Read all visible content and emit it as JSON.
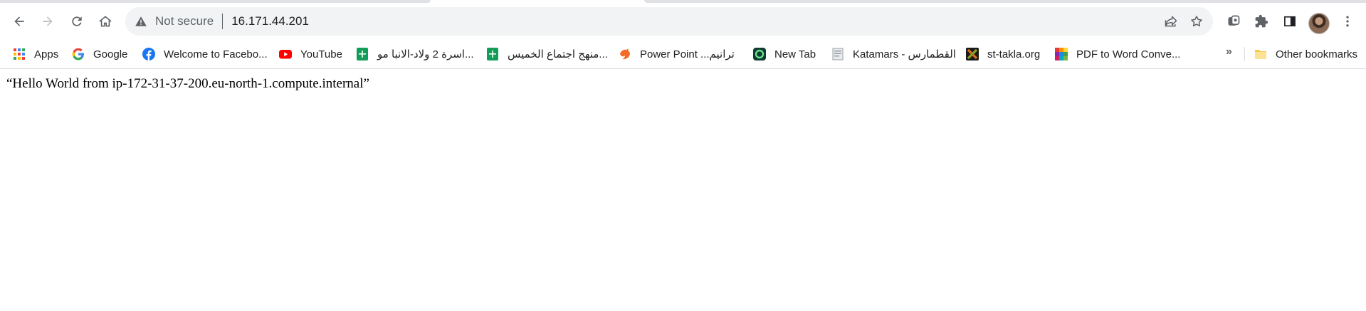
{
  "omnibox": {
    "security_label": "Not secure",
    "url": "16.171.44.201"
  },
  "bookmarks": [
    {
      "label": "Apps",
      "icon": "apps-grid-icon"
    },
    {
      "label": "Google",
      "icon": "google-icon"
    },
    {
      "label": "Welcome to Facebo...",
      "icon": "facebook-icon"
    },
    {
      "label": "YouTube",
      "icon": "youtube-icon"
    },
    {
      "label": "اسرة 2 ولاد-الانبا مو...",
      "icon": "google-sheets-icon"
    },
    {
      "label": "منهج اجتماع الخميس...",
      "icon": "google-sheets-icon"
    },
    {
      "label": "Power Point ...ترانيم",
      "icon": "orange-bird-icon"
    },
    {
      "label": "New Tab",
      "icon": "newtab-icon"
    },
    {
      "label": "Katamars - القطمارس",
      "icon": "katamars-icon"
    },
    {
      "label": "st-takla.org",
      "icon": "st-takla-icon"
    },
    {
      "label": "PDF to Word Conve...",
      "icon": "pdf-word-icon"
    }
  ],
  "bookmarks_overflow": "»",
  "other_bookmarks": "Other bookmarks",
  "page": {
    "text": "“Hello World from ip-172-31-37-200.eu-north-1.compute.internal”"
  },
  "colors": {
    "google_sheets": "#0f9d58",
    "youtube": "#ff0000",
    "facebook": "#1877f2",
    "folder": "#f7cb4d"
  }
}
